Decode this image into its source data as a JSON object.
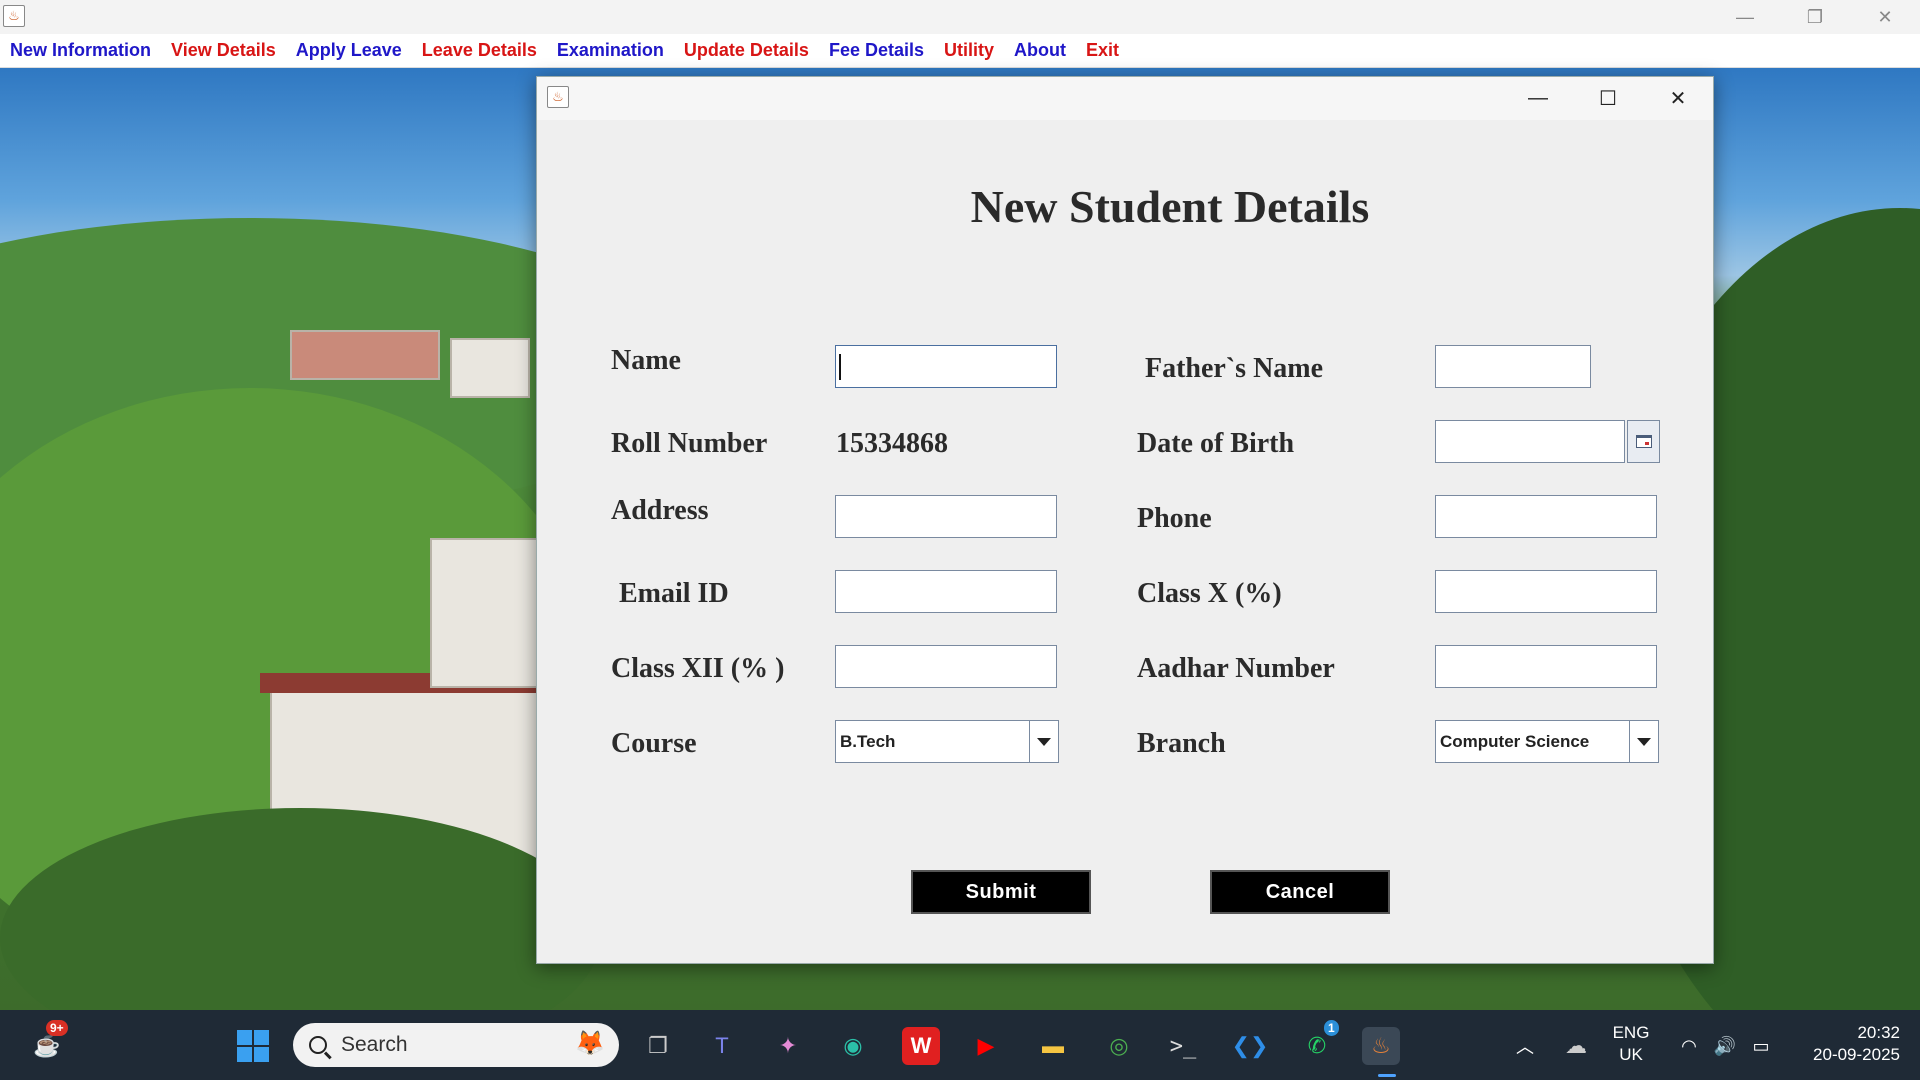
{
  "main_window": {
    "menu": [
      {
        "label": "New Information",
        "color": "#1f17c8"
      },
      {
        "label": "View Details",
        "color": "#d81515"
      },
      {
        "label": "Apply Leave",
        "color": "#1f17c8"
      },
      {
        "label": "Leave Details",
        "color": "#d81515"
      },
      {
        "label": "Examination",
        "color": "#1f17c8"
      },
      {
        "label": "Update Details",
        "color": "#d81515"
      },
      {
        "label": "Fee Details",
        "color": "#1f17c8"
      },
      {
        "label": "Utility",
        "color": "#d81515"
      },
      {
        "label": "About",
        "color": "#1f17c8"
      },
      {
        "label": "Exit",
        "color": "#d81515"
      }
    ],
    "controls": {
      "minimize": "—",
      "restore": "❐",
      "close": "✕"
    }
  },
  "dialog": {
    "title": "New Student Details",
    "controls": {
      "minimize": "—",
      "maximize": "☐",
      "close": "✕"
    },
    "labels": {
      "name": "Name",
      "roll_number": "Roll Number",
      "address": "Address",
      "email": "Email ID",
      "class_xii": "Class XII (% )",
      "course": "Course",
      "fathers_name": "Father`s Name",
      "dob": "Date of Birth",
      "phone": "Phone",
      "class_x": "Class X (%)",
      "aadhar": "Aadhar Number",
      "branch": "Branch"
    },
    "values": {
      "roll_number": "15334868",
      "name": "",
      "address": "",
      "email": "",
      "class_xii": "",
      "fathers_name": "",
      "dob": "",
      "phone": "",
      "class_x": "",
      "aadhar": ""
    },
    "course_selected": "B.Tech",
    "branch_selected": "Computer Science",
    "buttons": {
      "submit": "Submit",
      "cancel": "Cancel"
    }
  },
  "taskbar": {
    "search_placeholder": "Search",
    "widgets_badge": "9+",
    "whatsapp_badge": "1",
    "language": "ENG",
    "region": "UK",
    "time": "20:32",
    "date": "20-09-2025",
    "apps": [
      "start-icon",
      "task-view-icon",
      "teams-icon",
      "copilot-icon",
      "edge-icon",
      "wps-office-icon",
      "youtube-icon",
      "file-explorer-icon",
      "chrome-icon",
      "terminal-icon",
      "vscode-icon",
      "whatsapp-icon",
      "java-app-icon"
    ]
  }
}
